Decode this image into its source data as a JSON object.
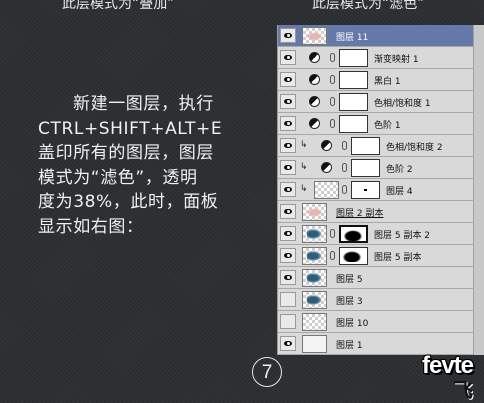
{
  "captions": {
    "left": "此层模式为“叠加”",
    "right": "此层模式为“滤色”"
  },
  "description": {
    "lines": [
      "新建一图层，执行",
      "CTRL+SHIFT+ALT+E",
      "盖印所有的图层，图层",
      "模式为“滤色”，透明",
      "度为38%，此时，面板",
      "显示如右图："
    ]
  },
  "page_number": "7",
  "logo": {
    "text": "fevte",
    "sub": "飞"
  },
  "layers_panel": {
    "top_layer_label": "",
    "layers": [
      {
        "name": "图层 11",
        "visible": true,
        "selected": true
      },
      {
        "name": "渐变映射 1",
        "visible": true,
        "type": "adjustment"
      },
      {
        "name": "黑白 1",
        "visible": true,
        "type": "adjustment"
      },
      {
        "name": "色相/饱和度 1",
        "visible": true,
        "type": "adjustment"
      },
      {
        "name": "色阶 1",
        "visible": true,
        "type": "adjustment"
      },
      {
        "name": "色相/饱和度 2",
        "visible": true,
        "type": "adjustment",
        "clipped": true
      },
      {
        "name": "色阶 2",
        "visible": true,
        "type": "adjustment",
        "clipped": true
      },
      {
        "name": "图层 4",
        "visible": true,
        "type": "masked",
        "clipped": true
      },
      {
        "name": "图层 2 副本",
        "visible": true,
        "type": "pixel"
      },
      {
        "name": "图层 5 副本 2",
        "visible": true,
        "type": "masked"
      },
      {
        "name": "图层 5 副本",
        "visible": true,
        "type": "masked"
      },
      {
        "name": "图层 5",
        "visible": true,
        "type": "pixel"
      },
      {
        "name": "图层 3",
        "visible": false,
        "type": "pixel"
      },
      {
        "name": "图层 10",
        "visible": false,
        "type": "pixel"
      },
      {
        "name": "图层 1",
        "visible": true,
        "type": "pixel"
      }
    ]
  }
}
